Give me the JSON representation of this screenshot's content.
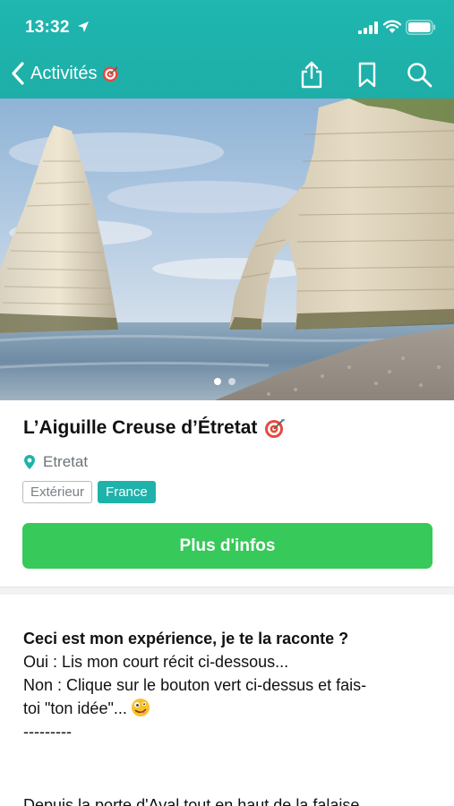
{
  "status_bar": {
    "time": "13:32",
    "location_icon": "location-arrow-icon",
    "signal_icon": "signal-bars-icon",
    "wifi_icon": "wifi-icon",
    "battery_icon": "battery-icon"
  },
  "nav": {
    "back_label": "Activités",
    "back_icon": "chevron-left-icon",
    "target_icon": "target-icon",
    "actions": [
      "share-icon",
      "bookmark-icon",
      "search-icon"
    ]
  },
  "colors": {
    "header": "#1daea7",
    "cta": "#37c95a",
    "tag_filled": "#1fb2ab"
  },
  "hero": {
    "carousel_pages": 2,
    "active_page": 1
  },
  "activity": {
    "title": "L’Aiguille Creuse d’Étretat",
    "location": "Etretat",
    "tags": [
      "Extérieur",
      "France"
    ],
    "cta_label": "Plus d'infos"
  },
  "story": {
    "heading": "Ceci est mon expérience, je te la raconte ?",
    "line1": "Oui : Lis mon court récit ci-dessous...",
    "line2a": "Non : Clique sur le bouton vert ci-dessus et fais-",
    "line2b": "toi \"ton idée\"...",
    "separator": "---------",
    "cutoff": "Depuis la porte d'Aval tout en haut de la falaise"
  }
}
